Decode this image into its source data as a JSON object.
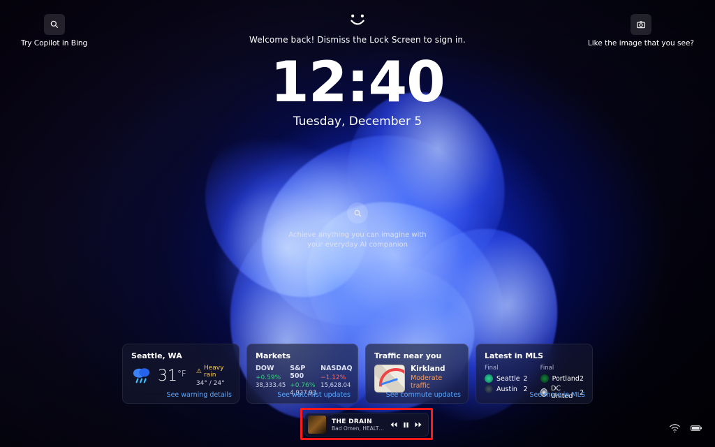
{
  "top": {
    "left_label": "Try Copilot in Bing",
    "right_label": "Like the image that you see?",
    "welcome": "Welcome back! Dismiss the Lock Screen to sign in."
  },
  "clock": {
    "time": "12:40",
    "date": "Tuesday, December 5"
  },
  "copilot": {
    "tagline": "Achieve anything you can imagine with your everyday AI companion"
  },
  "weather": {
    "title": "Seattle, WA",
    "temp": "31",
    "unit": "°F",
    "condition": "Heavy rain",
    "hi_lo": "34° / 24°",
    "link": "See warning details"
  },
  "markets": {
    "title": "Markets",
    "cols": [
      {
        "name": "DOW",
        "pct": "+0.59%",
        "dir": "up",
        "val": "38,333.45"
      },
      {
        "name": "S&P 500",
        "pct": "+0.76%",
        "dir": "up",
        "val": "4,927.93"
      },
      {
        "name": "NASDAQ",
        "pct": "−1.12%",
        "dir": "down",
        "val": "15,628.04"
      }
    ],
    "link": "See watchlist updates"
  },
  "traffic": {
    "title": "Traffic near you",
    "place": "Kirkland",
    "status": "Moderate traffic",
    "link": "See commute updates"
  },
  "mls": {
    "title": "Latest in MLS",
    "final": "Final",
    "games": [
      [
        {
          "team": "Seattle",
          "score": "2",
          "badge": "b-green"
        },
        {
          "team": "Austin",
          "score": "2",
          "badge": "b-navy"
        }
      ],
      [
        {
          "team": "Portland",
          "score": "2",
          "badge": "b-port"
        },
        {
          "team": "DC United",
          "score": "2",
          "badge": "b-dc"
        }
      ]
    ],
    "link": "See more in MLS"
  },
  "media": {
    "title": "THE DRAIN",
    "artist": "Bad Omen, HEALTH, S…"
  }
}
